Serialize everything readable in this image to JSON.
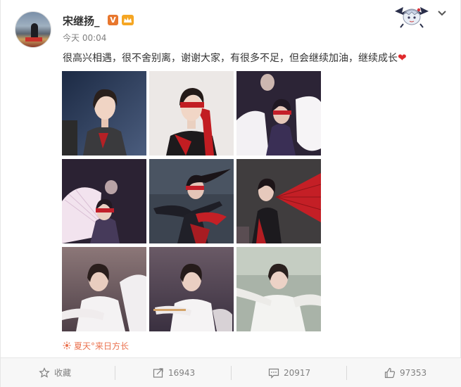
{
  "post": {
    "username": "宋继扬_",
    "v_badge": "V",
    "timestamp": "今天 00:04",
    "text": "很高兴相遇，很不舍别离，谢谢大家，有很多不足，但会继续加油，继续成长",
    "heart": "❤",
    "source": "夏天°来日方长"
  },
  "photos": [
    {
      "icon": "photo-red-blazer"
    },
    {
      "icon": "photo-red-blindfold"
    },
    {
      "icon": "photo-stage-white-fan"
    },
    {
      "icon": "photo-pink-fan"
    },
    {
      "icon": "photo-red-ribbon-dance"
    },
    {
      "icon": "photo-red-fan"
    },
    {
      "icon": "photo-white-robe-1"
    },
    {
      "icon": "photo-white-robe-2"
    },
    {
      "icon": "photo-white-robe-3"
    }
  ],
  "actions": {
    "favorite": "收藏",
    "repost": "16943",
    "comment": "20917",
    "like": "97353"
  },
  "colors": {
    "source_orange": "#eb7350",
    "badge_orange": "#e8772e",
    "heart_red": "#e0292c"
  }
}
